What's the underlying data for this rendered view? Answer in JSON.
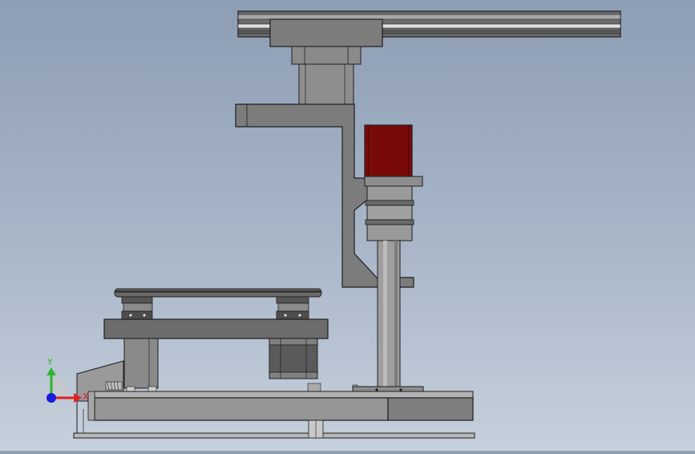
{
  "viewport": {
    "background_top": "#8d9db3",
    "background_bottom": "#c6d0dc"
  },
  "triad": {
    "y_label": "Y",
    "x_label": "X",
    "y_color": "#2fb52f",
    "x_color": "#e02020",
    "z_color": "#1a1adc"
  },
  "colors": {
    "part_gray": "#7b7b7b",
    "part_light": "#9a9a9a",
    "part_dark": "#4a4a4a",
    "motor_red": "#7a0a0a",
    "edge": "#1e1e1e"
  }
}
